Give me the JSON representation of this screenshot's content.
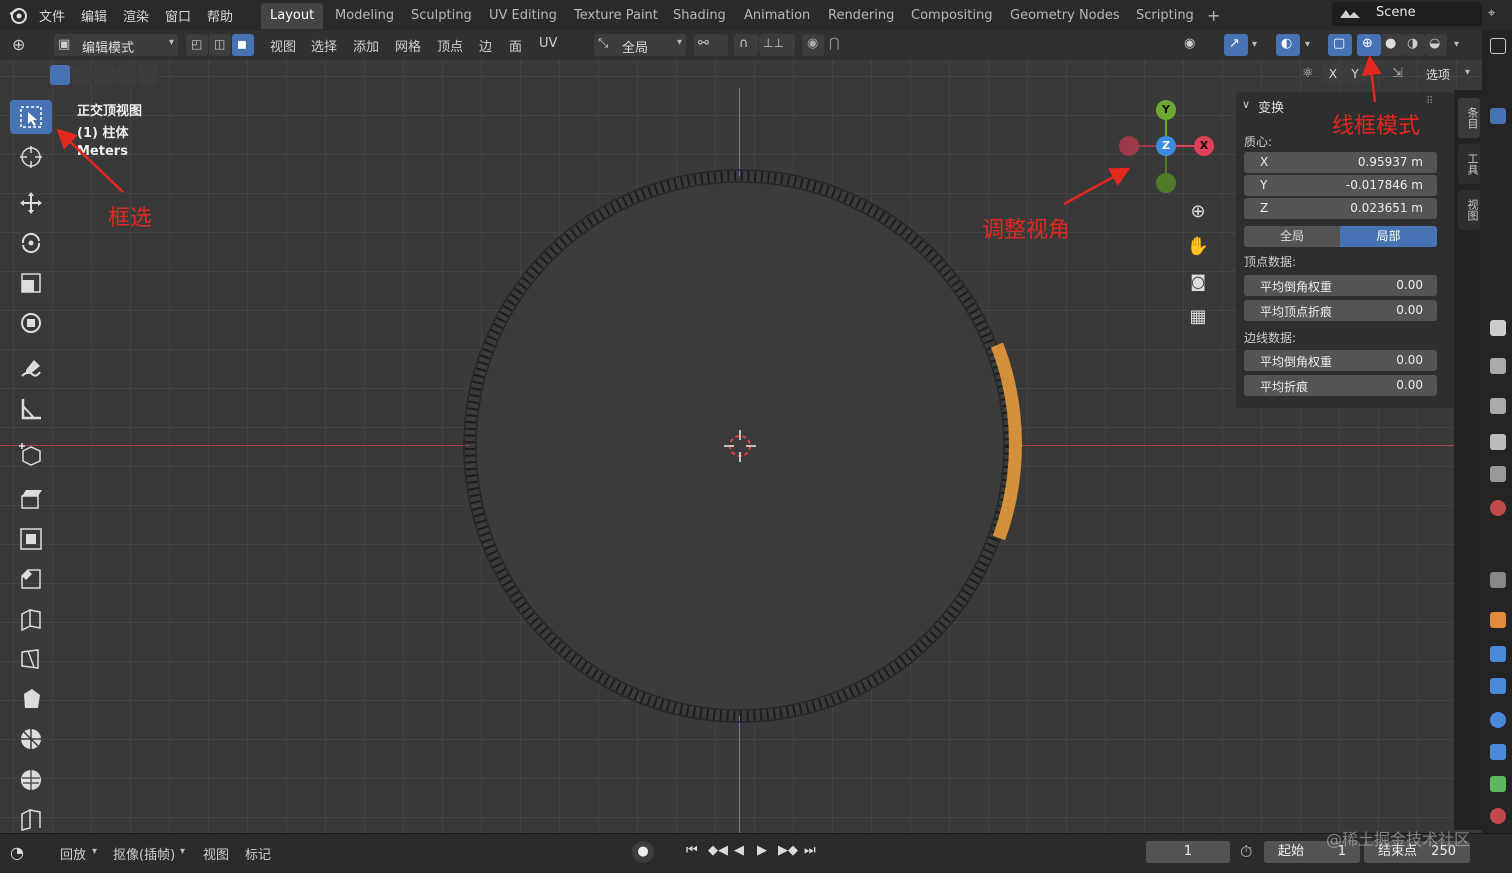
{
  "menu": {
    "items": [
      "文件",
      "编辑",
      "渲染",
      "窗口",
      "帮助"
    ]
  },
  "workspaces": {
    "tabs": [
      "Layout",
      "Modeling",
      "Sculpting",
      "UV Editing",
      "Texture Paint",
      "Shading",
      "Animation",
      "Rendering",
      "Compositing",
      "Geometry Nodes",
      "Scripting"
    ],
    "active": "Layout",
    "add_symbol": "+"
  },
  "scene": {
    "label": "Scene"
  },
  "header": {
    "mode": "编辑模式",
    "menus": [
      "视图",
      "选择",
      "添加",
      "网格",
      "顶点",
      "边",
      "面",
      "UV"
    ],
    "orientation": "全局",
    "axis_x": "X",
    "axis_y": "Y",
    "options": "选项"
  },
  "viewport": {
    "view_name": "正交顶视图",
    "object_name": "(1) 柱体",
    "units": "Meters"
  },
  "gizmo": {
    "x": "X",
    "y": "Y",
    "z": "Z"
  },
  "npanel": {
    "section": "变换",
    "centroid_label": "质心:",
    "fields": [
      {
        "key": "X",
        "value": "0.95937 m"
      },
      {
        "key": "Y",
        "value": "-0.017846 m"
      },
      {
        "key": "Z",
        "value": "0.023651 m"
      }
    ],
    "space_global": "全局",
    "space_local": "局部",
    "vertex_data_label": "顶点数据:",
    "vertex_fields": [
      {
        "key": "平均倒角权重",
        "value": "0.00"
      },
      {
        "key": "平均顶点折痕",
        "value": "0.00"
      }
    ],
    "edge_data_label": "边线数据:",
    "edge_fields": [
      {
        "key": "平均倒角权重",
        "value": "0.00"
      },
      {
        "key": "平均折痕",
        "value": "0.00"
      }
    ]
  },
  "side_tabs": [
    "条目",
    "工具",
    "视图"
  ],
  "timeline": {
    "playback": "回放",
    "keying": "抠像(插帧)",
    "view": "视图",
    "marker": "标记",
    "current_frame": "1",
    "start_label": "起始",
    "start_value": "1",
    "end_label": "结束点",
    "end_value": "250"
  },
  "annotations": {
    "box_select": "框选",
    "adjust_view": "调整视角",
    "wireframe_mode": "线框模式"
  },
  "watermark": "@稀土掘金技术社区",
  "colors": {
    "accent_blue": "#4772b3",
    "selection_orange": "#e49b3c",
    "axis_x_red": "#a6414a",
    "axis_y_green": "#6a9a2a",
    "annotation_red": "#e2281f"
  }
}
